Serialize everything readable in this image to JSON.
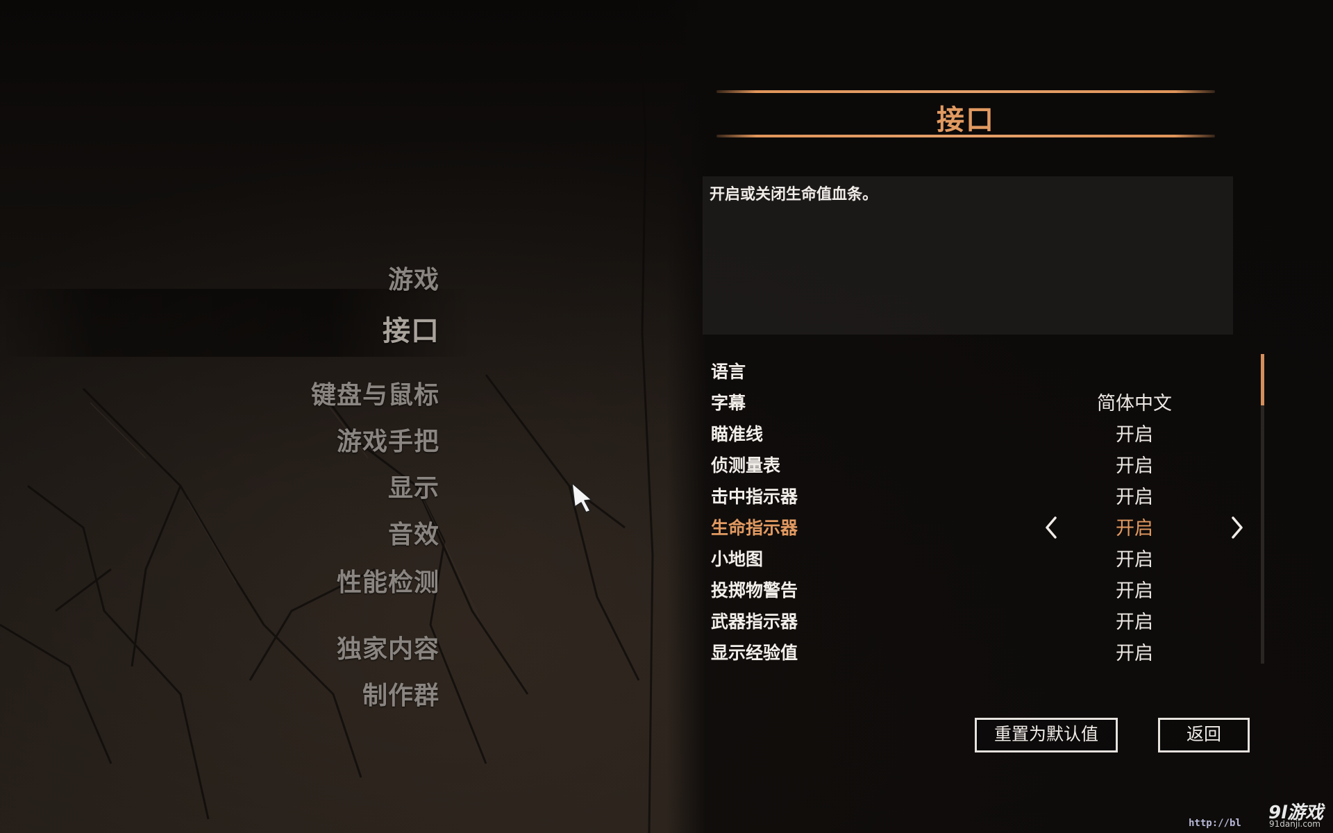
{
  "header": {
    "title": "接口"
  },
  "sidebar": {
    "items": [
      {
        "label": "游戏",
        "active": false
      },
      {
        "label": "接口",
        "active": true
      },
      {
        "label": "键盘与鼠标",
        "active": false
      },
      {
        "label": "游戏手把",
        "active": false
      },
      {
        "label": "显示",
        "active": false
      },
      {
        "label": "音效",
        "active": false
      },
      {
        "label": "性能检测",
        "active": false
      },
      {
        "label": "独家内容",
        "active": false
      },
      {
        "label": "制作群",
        "active": false
      }
    ]
  },
  "description": {
    "text": "开启或关闭生命值血条。"
  },
  "settings": {
    "rows": [
      {
        "label": "语言",
        "value": ""
      },
      {
        "label": "字幕",
        "value": "简体中文"
      },
      {
        "label": "瞄准线",
        "value": "开启"
      },
      {
        "label": "侦测量表",
        "value": "开启"
      },
      {
        "label": "击中指示器",
        "value": "开启"
      },
      {
        "label": "生命指示器",
        "value": "开启",
        "selected": true
      },
      {
        "label": "小地图",
        "value": "开启"
      },
      {
        "label": "投掷物警告",
        "value": "开启"
      },
      {
        "label": "武器指示器",
        "value": "开启"
      },
      {
        "label": "显示经验值",
        "value": "开启"
      }
    ]
  },
  "buttons": {
    "reset_label": "重置为默认值",
    "back_label": "返回"
  },
  "watermark": {
    "logo": "9l游戏",
    "site": "91danji.com",
    "url": "http://bl"
  },
  "colors": {
    "accent": "#e29a61",
    "text": "#f0ece8",
    "nav_text": "#8a8580"
  }
}
